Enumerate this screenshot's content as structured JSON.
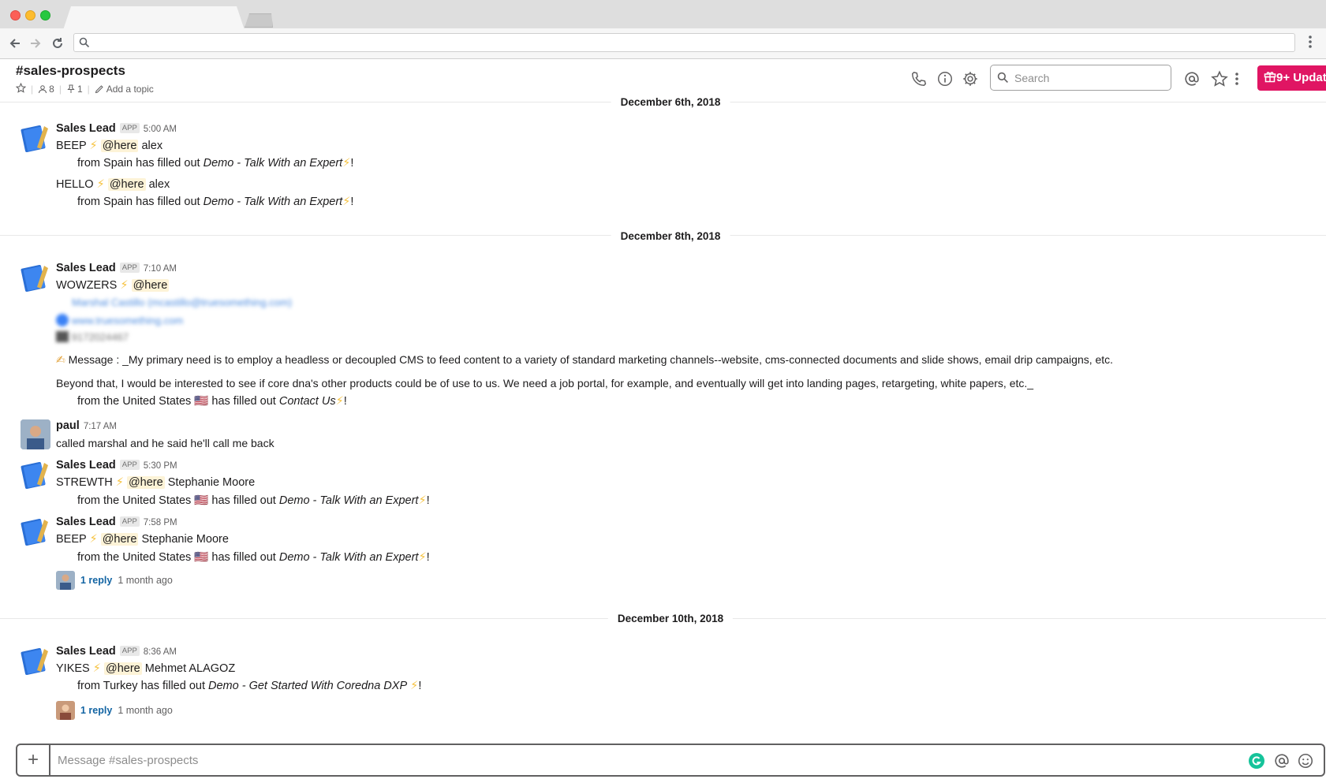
{
  "browser": {
    "address_value": ""
  },
  "channel": {
    "name": "#sales-prospects",
    "members": "8",
    "pins": "1",
    "topic_label": "Add a topic"
  },
  "header": {
    "search_placeholder": "Search",
    "update_label": "9+ Updat"
  },
  "dates": {
    "d1": "December 6th, 2018",
    "d2": "December 8th, 2018",
    "d3": "December 10th, 2018"
  },
  "app_badge": "APP",
  "bot_name": "Sales Lead",
  "mention": "@here",
  "messages": {
    "m1": {
      "time": "5:00 AM",
      "line1_prefix": "BEEP",
      "line1_name": "alex",
      "line2_pre": "from Spain  has filled out ",
      "line2_form": "Demo - Talk With an Expert",
      "line3_prefix": "HELLO",
      "line3_name": "alex",
      "line4_pre": "from Spain  has filled out ",
      "line4_form": "Demo - Talk With an Expert"
    },
    "m2": {
      "time": "7:10 AM",
      "line1_prefix": "WOWZERS",
      "blur1": "Marshal Castillo (mcastillo@truesomething.com)",
      "blur2": "www.truesomething.com",
      "blur3": "9172024467",
      "message_label": "Message :",
      "message_text": "_My primary need is to employ a headless or decoupled CMS to feed content to a variety of standard marketing channels--website, cms-connected documents and slide shows, email drip campaigns, etc.",
      "message_text2": "Beyond that, I would be interested to see if core dna's other products could be of use to us. We need a job portal, for example, and eventually will get into landing pages, retargeting, white papers, etc._",
      "line_from_pre": "from the United States",
      "line_from_mid": "has filled out ",
      "line_from_form": "Contact Us"
    },
    "m3": {
      "sender": "paul",
      "time": "7:17 AM",
      "text": "called marshal and he said he'll call me back"
    },
    "m4": {
      "time": "5:30 PM",
      "line1_prefix": "STREWTH",
      "line1_name": "Stephanie Moore",
      "line2_pre": "from the United States",
      "line2_mid": "has filled out ",
      "line2_form": "Demo - Talk With an Expert"
    },
    "m5": {
      "time": "7:58 PM",
      "line1_prefix": "BEEP",
      "line1_name": "Stephanie Moore",
      "line2_pre": "from the United States",
      "line2_mid": "has filled out ",
      "line2_form": "Demo - Talk With an Expert",
      "reply_count": "1 reply",
      "reply_time": "1 month ago"
    },
    "m6": {
      "time": "8:36 AM",
      "line1_prefix": "YIKES",
      "line1_name": "Mehmet ALAGOZ",
      "line2_pre": "from Turkey  has filled out ",
      "line2_form": "Demo - Get Started With Coredna DXP",
      "reply_count": "1 reply",
      "reply_time": "1 month ago"
    }
  },
  "composer": {
    "placeholder": "Message #sales-prospects"
  },
  "colors": {
    "accent": "#e01563",
    "link": "#1264a3",
    "mention_bg": "#fdf3d7"
  }
}
